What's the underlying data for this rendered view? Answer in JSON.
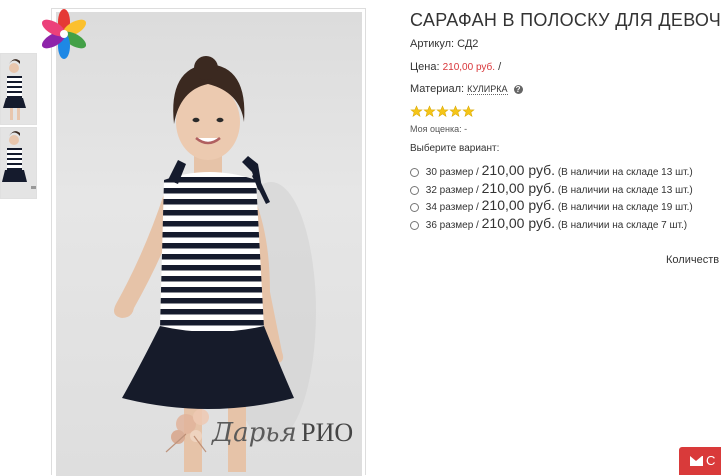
{
  "product": {
    "title": "САРАФАН В ПОЛОСКУ ДЛЯ ДЕВОЧКИ",
    "article_label": "Артикул:",
    "article_value": "СД2",
    "price_label": "Цена:",
    "price_value": "210,00 руб.",
    "price_sep": "/",
    "material_label": "Материал:",
    "material_value": "КУЛИРКА",
    "rating_stars": 5,
    "my_rating_label": "Моя оценка: -",
    "choose_variant_label": "Выберите вариант:",
    "variants": [
      {
        "size": "30 размер /",
        "price": "210,00 руб.",
        "stock": "(В наличии на складе 13 шт.)"
      },
      {
        "size": "32 размер /",
        "price": "210,00 руб.",
        "stock": "(В наличии на складе 13 шт.)"
      },
      {
        "size": "34 размер /",
        "price": "210,00 руб.",
        "stock": "(В наличии на складе 19 шт.)"
      },
      {
        "size": "36 размер /",
        "price": "210,00 руб.",
        "stock": "(В наличии на складе 7 шт.)"
      }
    ],
    "quantity_label": "Количеств"
  },
  "watermark": {
    "script": "Дарья",
    "caps": "РИО"
  },
  "feedback_button": {
    "label": "С"
  },
  "colors": {
    "price_red": "#d9363a",
    "button_red": "#d93a3a",
    "star_yellow": "#f5c518"
  },
  "icons": [
    "brand-flower-logo",
    "help-icon",
    "star-icon",
    "mail-icon"
  ]
}
